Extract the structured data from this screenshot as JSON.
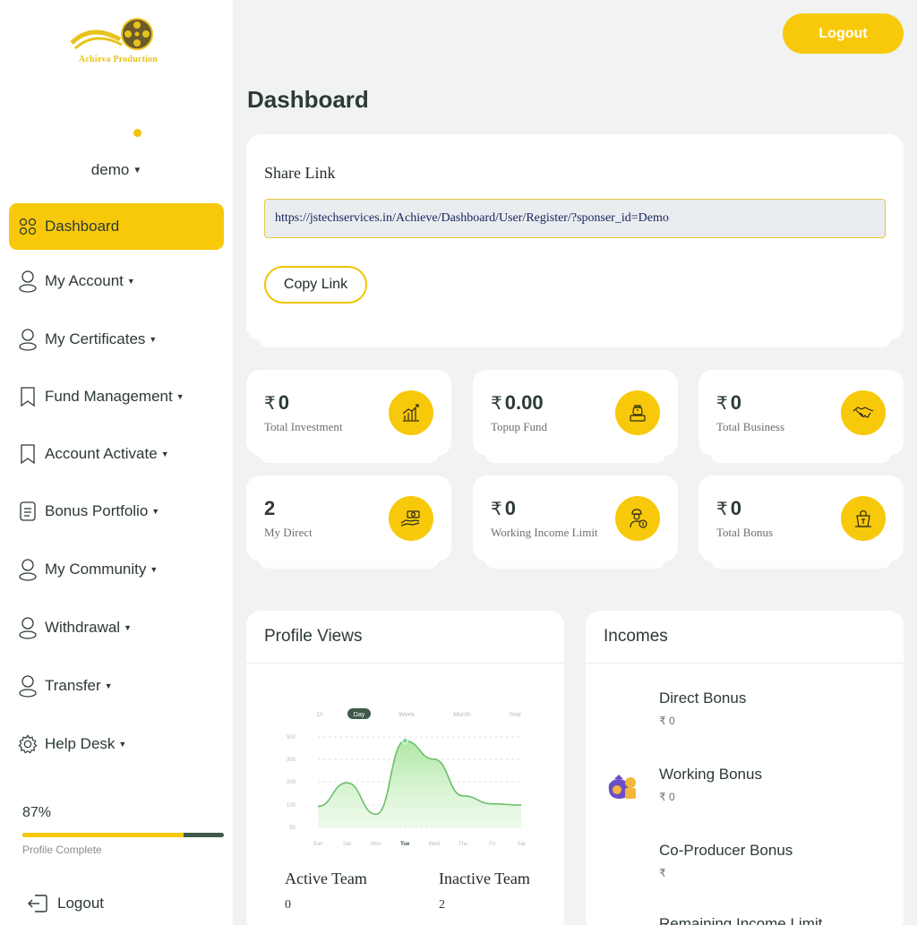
{
  "brand": {
    "logo_text": "Achieva Production"
  },
  "user": {
    "name": "demo"
  },
  "sidebar": {
    "items": [
      {
        "label": "Dashboard",
        "icon": "grid-icon",
        "has_caret": false
      },
      {
        "label": "My Account",
        "icon": "user-icon",
        "has_caret": true
      },
      {
        "label": "My Certificates",
        "icon": "user-icon",
        "has_caret": true
      },
      {
        "label": "Fund Management",
        "icon": "bookmark-icon",
        "has_caret": true
      },
      {
        "label": "Account Activate",
        "icon": "bookmark-icon",
        "has_caret": true
      },
      {
        "label": "Bonus Portfolio",
        "icon": "document-icon",
        "has_caret": true
      },
      {
        "label": "My Community",
        "icon": "user-icon",
        "has_caret": true
      },
      {
        "label": "Withdrawal",
        "icon": "user-icon",
        "has_caret": true
      },
      {
        "label": "Transfer",
        "icon": "user-icon",
        "has_caret": true
      },
      {
        "label": "Help Desk",
        "icon": "gear-icon",
        "has_caret": true
      }
    ],
    "profile_progress": {
      "percent_text": "87%",
      "fraction": 0.8,
      "label": "Profile Complete"
    },
    "logout_label": "Logout"
  },
  "header": {
    "logout_label": "Logout"
  },
  "page": {
    "title": "Dashboard"
  },
  "share": {
    "title": "Share Link",
    "url": "https://jstechservices.in/Achieve/Dashboard/User/Register/?sponser_id=Demo",
    "copy_label": "Copy Link"
  },
  "stats": [
    {
      "currency": "₹",
      "value": "0",
      "label": "Total Investment",
      "icon": "growth-chart-icon"
    },
    {
      "currency": "₹",
      "value": "0.00",
      "label": "Topup Fund",
      "icon": "money-bag-icon"
    },
    {
      "currency": "₹",
      "value": "0",
      "label": "Total Business",
      "icon": "handshake-icon"
    },
    {
      "currency": "",
      "value": "2",
      "label": "My Direct",
      "icon": "hand-money-icon"
    },
    {
      "currency": "₹",
      "value": "0",
      "label": "Working Income Limit",
      "icon": "worker-coin-icon"
    },
    {
      "currency": "₹",
      "value": "0",
      "label": "Total Bonus",
      "icon": "bonus-bag-icon"
    }
  ],
  "profile_views": {
    "title": "Profile Views",
    "tabs": [
      "1h",
      "Day",
      "Week",
      "Month",
      "Year"
    ],
    "active_tab": "Day",
    "y_ticks": [
      "500",
      "300",
      "200",
      "100",
      "50"
    ],
    "x_ticks": [
      "Sun",
      "Sat",
      "Mon",
      "Tue",
      "Wed",
      "Thu",
      "Fri",
      "Sat"
    ],
    "team": {
      "active_label": "Active Team",
      "active_value": "0",
      "inactive_label": "Inactive Team",
      "inactive_value": "2"
    }
  },
  "chart_data": {
    "type": "area",
    "categories": [
      "Sun",
      "Sat",
      "Mon",
      "Tue",
      "Wed",
      "Thu",
      "Fri",
      "Sat"
    ],
    "series": [
      {
        "values": [
          80,
          170,
          50,
          330,
          260,
          120,
          90,
          85
        ]
      }
    ],
    "ylim": [
      0,
      500
    ],
    "color": "#7fcf7f"
  },
  "incomes": {
    "title": "Incomes",
    "items": [
      {
        "title": "Direct Bonus",
        "value": "₹ 0"
      },
      {
        "title": "Working Bonus",
        "value": "₹ 0"
      },
      {
        "title": "Co-Producer Bonus",
        "value": "₹"
      },
      {
        "title": "Remaining Income Limit",
        "value": ""
      }
    ]
  },
  "colors": {
    "accent": "#f8c90a",
    "background": "#f0f3f2",
    "dark": "#3f5a4c"
  }
}
